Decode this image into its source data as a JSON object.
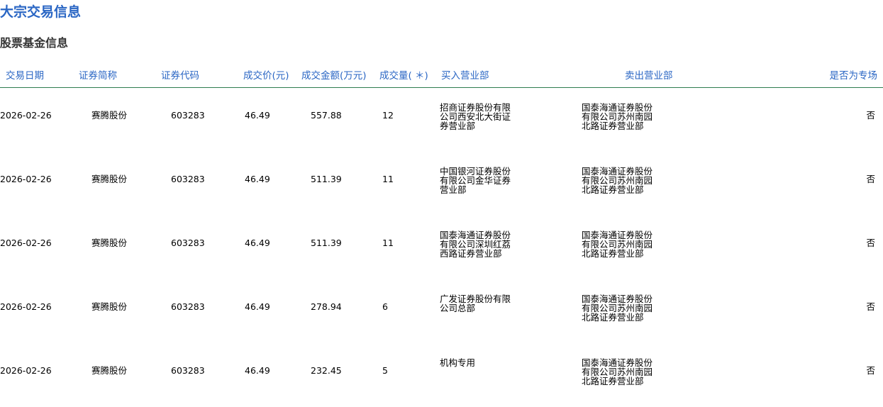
{
  "page_title": "大宗交易信息",
  "section_title": "股票基金信息",
  "table": {
    "headers": [
      "交易日期",
      "证券简称",
      "证券代码",
      "成交价(元)",
      "成交金额(万元)",
      "成交量( ＊)",
      "买入营业部",
      "卖出营业部",
      "是否为专场"
    ],
    "rows": [
      {
        "date": "2026-02-26",
        "name": "赛腾股份",
        "code": "603283",
        "price": "46.49",
        "amount": "557.88",
        "volume": "12",
        "buyer": "招商证券股份有限公司西安北大街证券营业部",
        "seller": "国泰海通证券股份有限公司苏州南园北路证券营业部",
        "special": "否"
      },
      {
        "date": "2026-02-26",
        "name": "赛腾股份",
        "code": "603283",
        "price": "46.49",
        "amount": "511.39",
        "volume": "11",
        "buyer": "中国银河证券股份有限公司金华证券营业部",
        "seller": "国泰海通证券股份有限公司苏州南园北路证券营业部",
        "special": "否"
      },
      {
        "date": "2026-02-26",
        "name": "赛腾股份",
        "code": "603283",
        "price": "46.49",
        "amount": "511.39",
        "volume": "11",
        "buyer": "国泰海通证券股份有限公司深圳红荔西路证券营业部",
        "seller": "国泰海通证券股份有限公司苏州南园北路证券营业部",
        "special": "否"
      },
      {
        "date": "2026-02-26",
        "name": "赛腾股份",
        "code": "603283",
        "price": "46.49",
        "amount": "278.94",
        "volume": "6",
        "buyer": "广发证券股份有限公司总部",
        "seller": "国泰海通证券股份有限公司苏州南园北路证券营业部",
        "special": "否"
      },
      {
        "date": "2026-02-26",
        "name": "赛腾股份",
        "code": "603283",
        "price": "46.49",
        "amount": "232.45",
        "volume": "5",
        "buyer": "机构专用",
        "seller": "国泰海通证券股份有限公司苏州南园北路证券营业部",
        "special": "否"
      }
    ]
  },
  "colors": {
    "title": "#2a66c4",
    "header_text": "#2a66c4",
    "header_rule": "#2e7d4f"
  }
}
